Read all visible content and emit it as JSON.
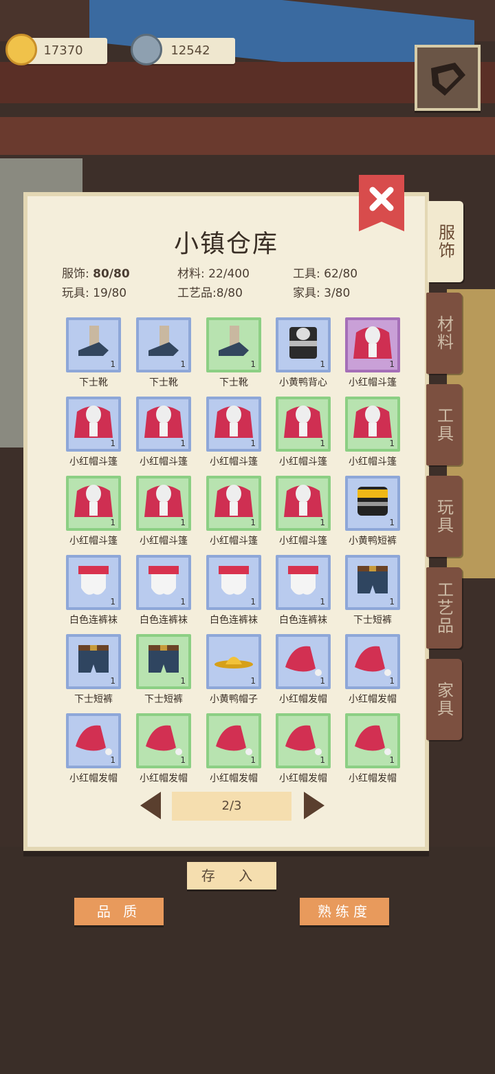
{
  "header": {
    "gold": "17370",
    "silver": "12542"
  },
  "colors": {
    "panel": "#f4eedb",
    "close": "#d84c4c",
    "button_orange": "#e89a5c",
    "tab_dark": "#7c5040"
  },
  "panel": {
    "title": "小镇仓库",
    "stats": {
      "clothing_label": "服饰:",
      "clothing_value": "80/80",
      "materials": "材料: 22/400",
      "tools": "工具: 62/80",
      "toys": "玩具: 19/80",
      "crafts": "工艺品:8/80",
      "furniture": "家具: 3/80"
    },
    "items": [
      {
        "name": "下士靴",
        "qty": "1",
        "rarity": "blue",
        "icon": "boot-icon"
      },
      {
        "name": "下士靴",
        "qty": "1",
        "rarity": "blue",
        "icon": "boot-icon"
      },
      {
        "name": "下士靴",
        "qty": "1",
        "rarity": "green",
        "icon": "boot-icon"
      },
      {
        "name": "小黄鸭背心",
        "qty": "1",
        "rarity": "blue",
        "icon": "vest-icon"
      },
      {
        "name": "小红帽斗篷",
        "qty": "1",
        "rarity": "purple",
        "icon": "cloak-icon"
      },
      {
        "name": "小红帽斗篷",
        "qty": "1",
        "rarity": "blue",
        "icon": "cloak-icon"
      },
      {
        "name": "小红帽斗篷",
        "qty": "1",
        "rarity": "blue",
        "icon": "cloak-icon"
      },
      {
        "name": "小红帽斗篷",
        "qty": "1",
        "rarity": "blue",
        "icon": "cloak-icon"
      },
      {
        "name": "小红帽斗篷",
        "qty": "1",
        "rarity": "green",
        "icon": "cloak-icon"
      },
      {
        "name": "小红帽斗篷",
        "qty": "1",
        "rarity": "green",
        "icon": "cloak-icon"
      },
      {
        "name": "小红帽斗篷",
        "qty": "1",
        "rarity": "green",
        "icon": "cloak-icon"
      },
      {
        "name": "小红帽斗篷",
        "qty": "1",
        "rarity": "green",
        "icon": "cloak-icon"
      },
      {
        "name": "小红帽斗篷",
        "qty": "1",
        "rarity": "green",
        "icon": "cloak-icon"
      },
      {
        "name": "小红帽斗篷",
        "qty": "1",
        "rarity": "green",
        "icon": "cloak-icon"
      },
      {
        "name": "小黄鸭短裤",
        "qty": "1",
        "rarity": "blue",
        "icon": "yellow-shorts-icon"
      },
      {
        "name": "白色连裤袜",
        "qty": "1",
        "rarity": "blue",
        "icon": "stockings-icon"
      },
      {
        "name": "白色连裤袜",
        "qty": "1",
        "rarity": "blue",
        "icon": "stockings-icon"
      },
      {
        "name": "白色连裤袜",
        "qty": "1",
        "rarity": "blue",
        "icon": "stockings-icon"
      },
      {
        "name": "白色连裤袜",
        "qty": "1",
        "rarity": "blue",
        "icon": "stockings-icon"
      },
      {
        "name": "下士短裤",
        "qty": "1",
        "rarity": "blue",
        "icon": "shorts-icon"
      },
      {
        "name": "下士短裤",
        "qty": "1",
        "rarity": "blue",
        "icon": "shorts-icon"
      },
      {
        "name": "下士短裤",
        "qty": "1",
        "rarity": "green",
        "icon": "shorts-icon"
      },
      {
        "name": "小黄鸭帽子",
        "qty": "1",
        "rarity": "blue",
        "icon": "hat-icon"
      },
      {
        "name": "小红帽发帽",
        "qty": "1",
        "rarity": "blue",
        "icon": "red-hood-hat-icon"
      },
      {
        "name": "小红帽发帽",
        "qty": "1",
        "rarity": "blue",
        "icon": "red-hood-hat-icon"
      },
      {
        "name": "小红帽发帽",
        "qty": "1",
        "rarity": "blue",
        "icon": "red-hood-hat-icon"
      },
      {
        "name": "小红帽发帽",
        "qty": "1",
        "rarity": "green",
        "icon": "red-hood-hat-icon"
      },
      {
        "name": "小红帽发帽",
        "qty": "1",
        "rarity": "green",
        "icon": "red-hood-hat-icon"
      },
      {
        "name": "小红帽发帽",
        "qty": "1",
        "rarity": "green",
        "icon": "red-hood-hat-icon"
      },
      {
        "name": "小红帽发帽",
        "qty": "1",
        "rarity": "green",
        "icon": "red-hood-hat-icon"
      }
    ],
    "pager": "2/3"
  },
  "tabs": [
    {
      "label": "服饰",
      "active": true
    },
    {
      "label": "材料",
      "active": false
    },
    {
      "label": "工具",
      "active": false
    },
    {
      "label": "玩具",
      "active": false
    },
    {
      "label": "工艺品",
      "active": false
    },
    {
      "label": "家具",
      "active": false
    }
  ],
  "buttons": {
    "store": "存 入",
    "quality": "品 质",
    "proficiency": "熟练度"
  }
}
